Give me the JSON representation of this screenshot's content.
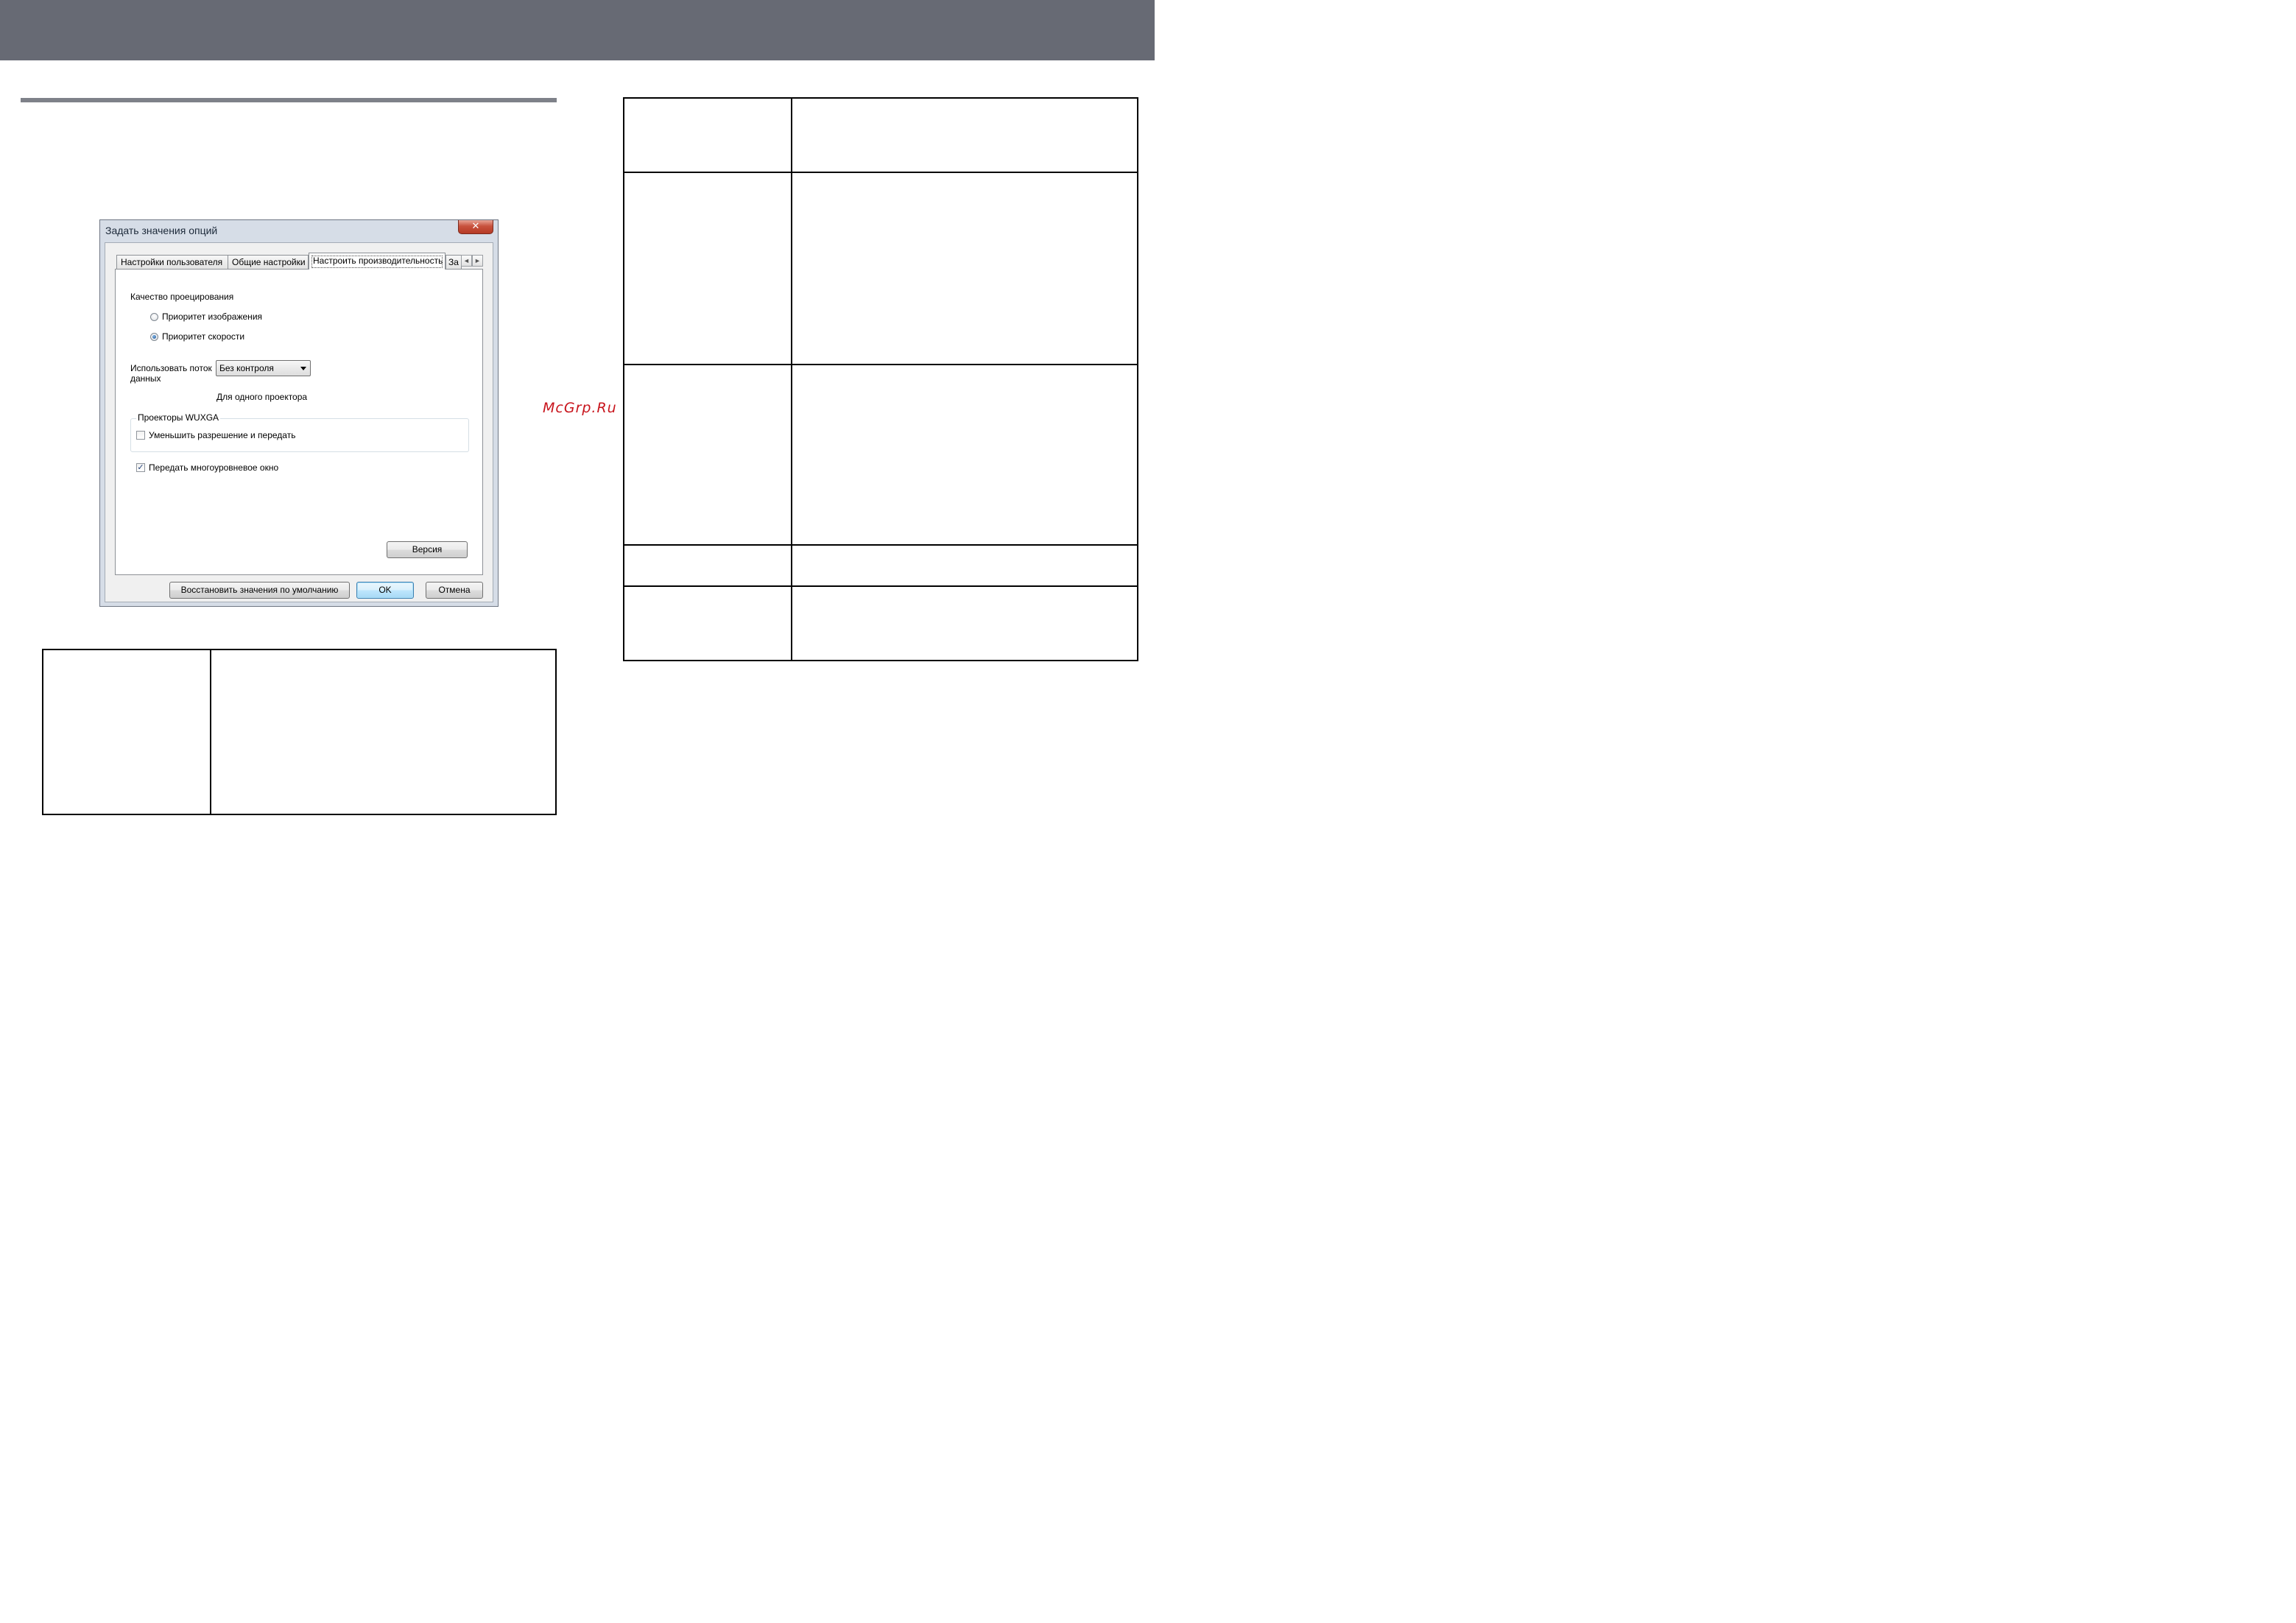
{
  "watermark": "McGrp.Ru",
  "dialog": {
    "title": "Задать значения опций",
    "close_glyph": "✕",
    "tabs": [
      {
        "label": "Настройки пользователя"
      },
      {
        "label": "Общие настройки"
      },
      {
        "label": "Настроить производительность"
      },
      {
        "label": "За"
      }
    ],
    "tab_scroll_left": "◄",
    "tab_scroll_right": "►",
    "quality_label": "Качество проецирования",
    "radio_image_priority": "Приоритет изображения",
    "radio_speed_priority": "Приоритет скорости",
    "selected_quality": "Приоритет скорости",
    "data_stream_label_line1": "Использовать поток",
    "data_stream_label_line2": "данных",
    "data_stream_value": "Без контроля",
    "single_projector_note": "Для одного проектора",
    "wuxga_group_title": "Проекторы WUXGA",
    "reduce_resolution_label": "Уменьшить разрешение и передать",
    "reduce_resolution_checked": false,
    "layered_window_label": "Передать многоуровневое окно",
    "layered_window_checked": true,
    "check_glyph": "✓",
    "version_button": "Версия",
    "restore_defaults_button": "Восстановить значения по умолчанию",
    "ok_button": "OK",
    "cancel_button": "Отмена"
  },
  "colors": {
    "banner": "#676a74",
    "section_rule": "#7e8189",
    "watermark": "#c8141c"
  }
}
